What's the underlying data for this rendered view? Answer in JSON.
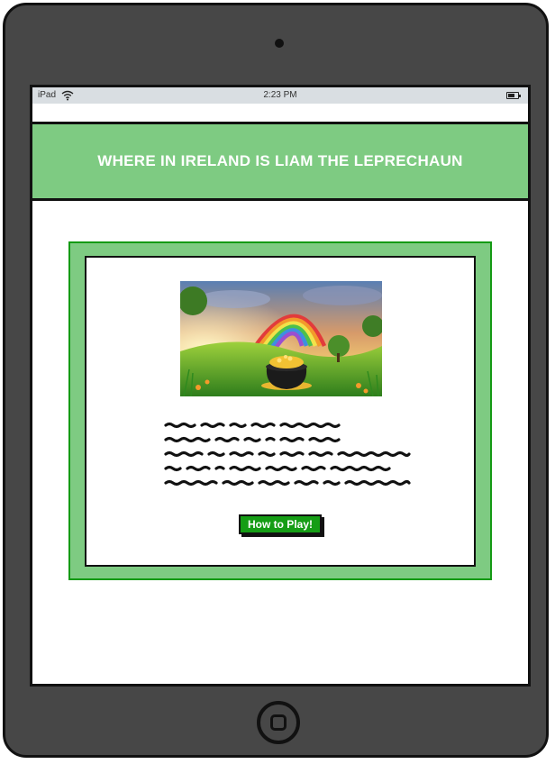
{
  "status_bar": {
    "carrier": "iPad",
    "time": "2:23 PM"
  },
  "header": {
    "title": "WHERE IN IRELAND IS LIAM THE LEPRECHAUN"
  },
  "main": {
    "image_icon": "rainbow-pot-of-gold-image",
    "button_label": "How to Play!"
  },
  "colors": {
    "header_green": "#7ecb82",
    "card_border_green": "#149a14",
    "button_green": "#159d15",
    "device_gray": "#474747"
  }
}
